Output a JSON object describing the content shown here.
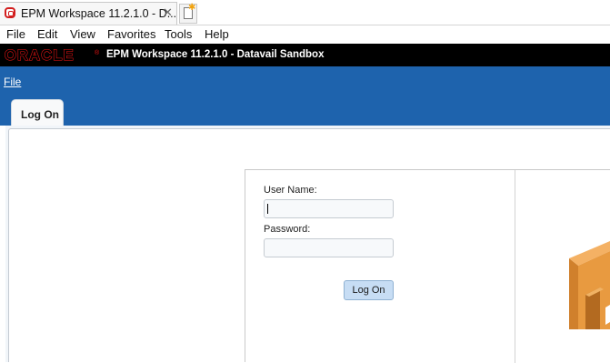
{
  "browser": {
    "tab_title": "EPM Workspace 11.2.1.0 - D...",
    "tab_close_glyph": "✕",
    "menu": [
      "File",
      "Edit",
      "View",
      "Favorites",
      "Tools",
      "Help"
    ]
  },
  "brand": {
    "logo_text": "ORACLE",
    "logo_registered": "®",
    "app_title": "EPM Workspace 11.2.1.0 - Datavail Sandbox",
    "logo_color": "#f01414"
  },
  "app": {
    "file_menu": "File",
    "active_tab": "Log On",
    "header_color": "#1e63ad"
  },
  "login": {
    "username_label": "User Name:",
    "username_value": "",
    "password_label": "Password:",
    "password_value": "",
    "submit_label": "Log On"
  },
  "icons": {
    "browser_tab_favicon": "oracle-o-icon",
    "new_tab": "new-tab-icon",
    "illustration": "orange-3d-block-illustration"
  }
}
